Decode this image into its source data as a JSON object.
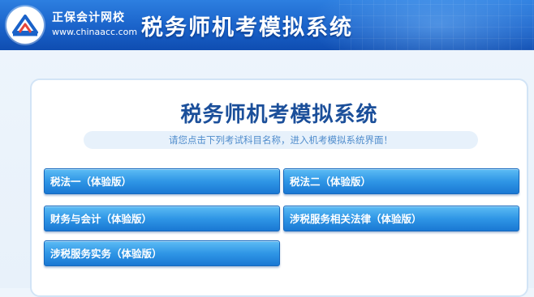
{
  "header": {
    "brand_name": "正保会计网校",
    "brand_url": "www.chinaacc.com",
    "system_title": "税务师机考模拟系统"
  },
  "main": {
    "title": "税务师机考模拟系统",
    "instruction": "请您点击下列考试科目名称，进入机考模拟系统界面！",
    "subjects": [
      {
        "label": "税法一（体验版）"
      },
      {
        "label": "税法二（体验版）"
      },
      {
        "label": "财务与会计（体验版）"
      },
      {
        "label": "涉税服务相关法律（体验版）"
      },
      {
        "label": "涉税服务实务（体验版）"
      }
    ]
  },
  "icons": {
    "logo": "chinaacc-logo-icon"
  },
  "colors": {
    "header_blue": "#1a62c9",
    "title_blue": "#1b4f9a",
    "button_blue": "#2f96e6",
    "notice_text": "#4f8ccc"
  }
}
